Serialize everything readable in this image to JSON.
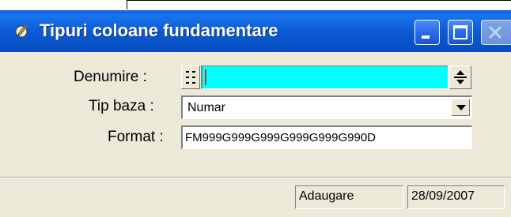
{
  "window": {
    "title": "Tipuri coloane fundamentare",
    "title_icon": "app-pencil-icon",
    "titlebar_color": "#0a5fd8",
    "buttons": {
      "minimize_icon": "minimize-icon",
      "maximize_icon": "maximize-icon",
      "close_icon": "close-icon"
    }
  },
  "form": {
    "denumire": {
      "label": "Denumire :",
      "value": "",
      "background": "#00ffff",
      "grip_icon": "grip-icon",
      "spinner_icon": "spinner-icon"
    },
    "tip_baza": {
      "label": "Tip baza :",
      "value": "Numar",
      "dropdown_icon": "dropdown-arrow-icon"
    },
    "format": {
      "label": "Format :",
      "value": "FM999G999G999G999G999G990D"
    }
  },
  "statusbar": {
    "mode": "Adaugare",
    "date": "28/09/2007"
  }
}
